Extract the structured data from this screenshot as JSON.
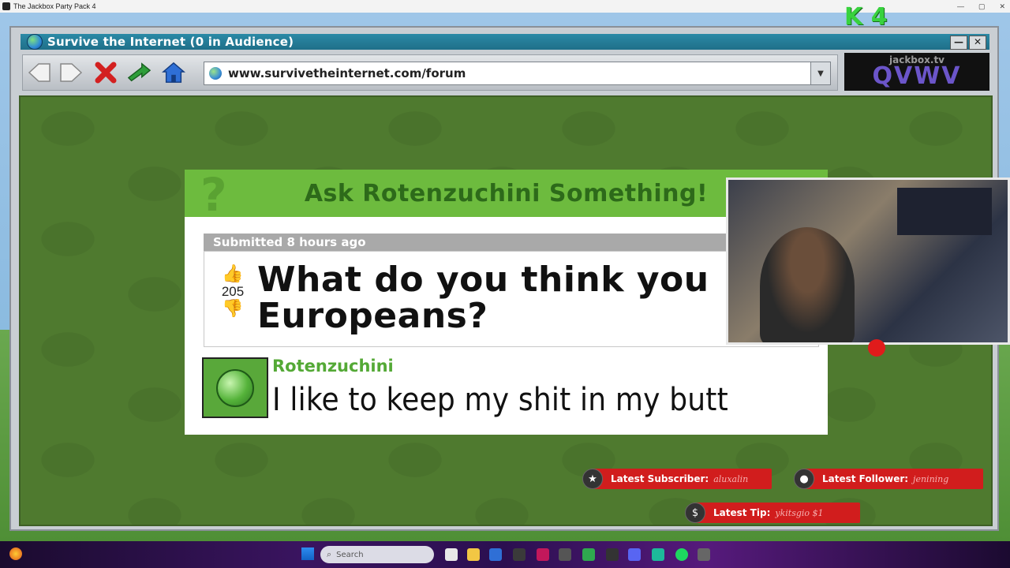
{
  "os_window": {
    "title": "The Jackbox Party Pack 4",
    "controls": [
      "—",
      "▢",
      "✕"
    ]
  },
  "brand_logo": "K 4",
  "browser": {
    "title": "Survive the Internet  (0 in Audience)",
    "url": "www.survivetheinternet.com/forum",
    "nav_icons": [
      "back-arrow-icon",
      "forward-arrow-icon",
      "stop-x-icon",
      "refresh-arrow-icon",
      "home-icon"
    ],
    "minimize_label": "—",
    "close_label": "✕",
    "dropdown_label": "▼"
  },
  "room": {
    "site": "jackbox.tv",
    "code": "QVWV"
  },
  "forum": {
    "header": "Ask Rotenzuchini Something!",
    "header_glyph": "?",
    "submitted": "Submitted 8 hours ago",
    "vote_up_icon": "👍",
    "votes": "205",
    "vote_down_icon": "👎",
    "question": "What do you think you Europeans?",
    "reply_author": "Rotenzuchini",
    "reply_text": "I like to keep my shit in my butt"
  },
  "alerts": {
    "subscriber_label": "Latest Subscriber:",
    "subscriber_value": "aluxalin",
    "follower_label": "Latest Follower:",
    "follower_value": "jenining",
    "tip_label": "Latest Tip:",
    "tip_value": "ykitsgio $1",
    "subscriber_icon": "★",
    "follower_icon": "●",
    "tip_icon": "$"
  },
  "taskbar": {
    "search_placeholder": "Search",
    "search_icon": "⌕"
  },
  "colors": {
    "title_bar": "#1f6f89",
    "forum_green": "#6dbb3e",
    "page_green": "#4f7a2f",
    "alert_red": "#d11d1d",
    "room_code": "#6b55c9"
  }
}
